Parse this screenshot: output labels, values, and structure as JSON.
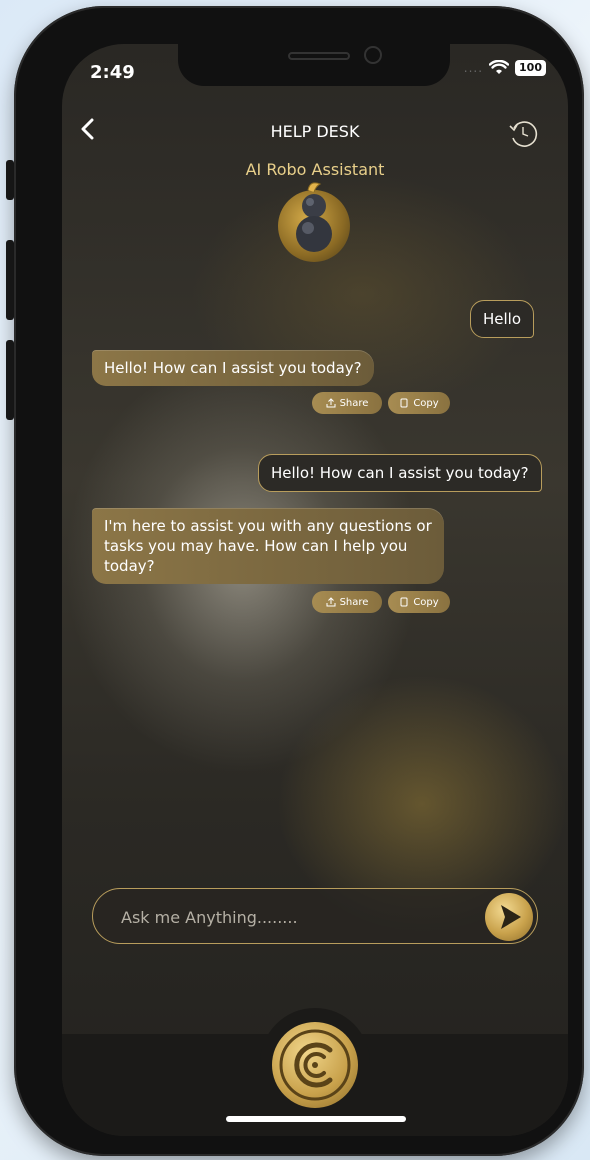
{
  "status_bar": {
    "time": "2:49",
    "signal": "....",
    "battery": "100"
  },
  "header": {
    "title": "HELP DESK",
    "assistant_name": "AI Robo Assistant"
  },
  "messages": [
    {
      "role": "user",
      "text": "Hello"
    },
    {
      "role": "bot",
      "text": "Hello! How can I assist you today?",
      "actions": {
        "share": "Share",
        "copy": "Copy"
      }
    },
    {
      "role": "user",
      "text": "Hello! How can I assist you today?"
    },
    {
      "role": "bot",
      "text": "I'm here to assist you with any questions or tasks you may have. How can I help you today?",
      "actions": {
        "share": "Share",
        "copy": "Copy"
      }
    }
  ],
  "input": {
    "placeholder": "Ask me Anything........"
  },
  "colors": {
    "accent": "#c9a24c",
    "bubble_bot": "#7c6a42",
    "background": "#2a2824"
  }
}
